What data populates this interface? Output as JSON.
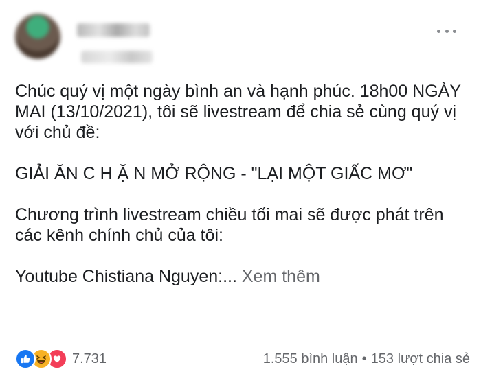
{
  "post": {
    "lines": [
      "Chúc quý vị một ngày bình an và hạnh phúc. 18h00 NGÀY MAI (13/10/2021), tôi sẽ livestream để chia sẻ cùng quý vị với chủ đề:",
      "GIẢI ĂN C H Ặ N MỞ RỘNG - \"LẠI MỘT GIẤC MƠ\"",
      "Chương trình livestream chiều tối mai sẽ được phát trên các kênh chính chủ của tôi:"
    ],
    "last_line": "Youtube Chistiana Nguyen:...",
    "see_more": "Xem thêm"
  },
  "footer": {
    "reaction_icons": [
      "like-icon",
      "haha-icon",
      "love-icon"
    ],
    "reaction_count": "7.731",
    "comments": "1.555 bình luận",
    "separator": "•",
    "shares": "153 lượt chia sẻ"
  },
  "colors": {
    "like": "#1877f2",
    "haha": "#f7b125",
    "love": "#f33e58",
    "secondary_text": "#65676b"
  }
}
